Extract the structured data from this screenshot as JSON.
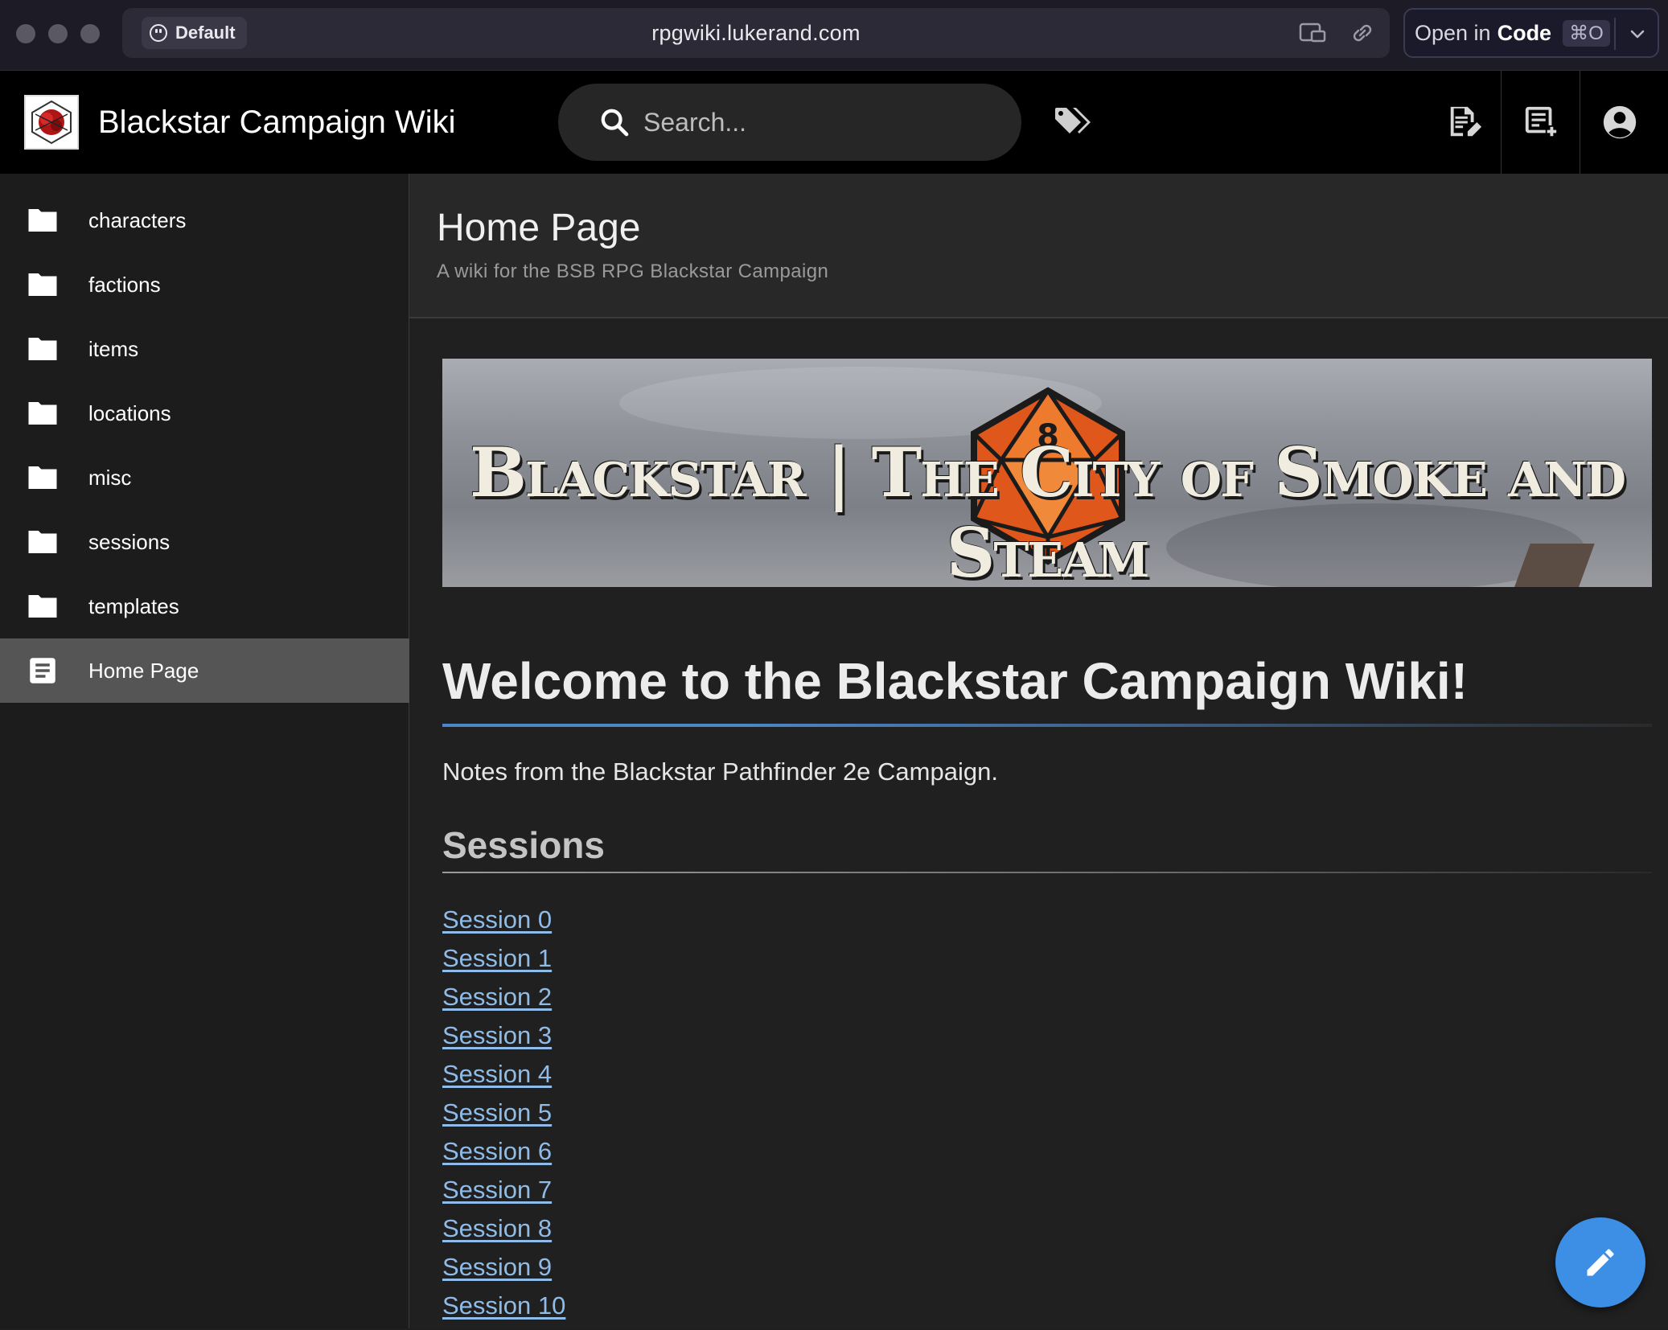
{
  "browser": {
    "profile_label": "Default",
    "url": "rpgwiki.lukerand.com",
    "open_in_label": "Open in",
    "open_in_app": "Code",
    "open_in_shortcut": "⌘O"
  },
  "header": {
    "title": "Blackstar Campaign Wiki",
    "search_placeholder": "Search..."
  },
  "sidebar": {
    "items": [
      {
        "label": "characters",
        "icon": "folder-icon"
      },
      {
        "label": "factions",
        "icon": "folder-icon"
      },
      {
        "label": "items",
        "icon": "folder-icon"
      },
      {
        "label": "locations",
        "icon": "folder-icon"
      },
      {
        "label": "misc",
        "icon": "folder-icon"
      },
      {
        "label": "sessions",
        "icon": "folder-icon"
      },
      {
        "label": "templates",
        "icon": "folder-icon"
      },
      {
        "label": "Home Page",
        "icon": "document-icon",
        "active": true
      }
    ]
  },
  "page": {
    "title": "Home Page",
    "description": "A wiki for the BSB RPG Blackstar Campaign",
    "banner_text": "Blackstar | The City of Smoke and Steam",
    "banner_die_number": "8",
    "heading": "Welcome to the Blackstar Campaign Wiki!",
    "intro": "Notes from the Blackstar Pathfinder 2e Campaign.",
    "sessions_heading": "Sessions",
    "sessions": [
      "Session 0",
      "Session 1",
      "Session 2",
      "Session 3",
      "Session 4",
      "Session 5",
      "Session 6",
      "Session 7",
      "Session 8",
      "Session 9",
      "Session 10"
    ]
  },
  "colors": {
    "accent": "#3d8fe6",
    "link": "#8fbbe9",
    "header_bg": "#000000",
    "sidebar_active": "#555555"
  }
}
